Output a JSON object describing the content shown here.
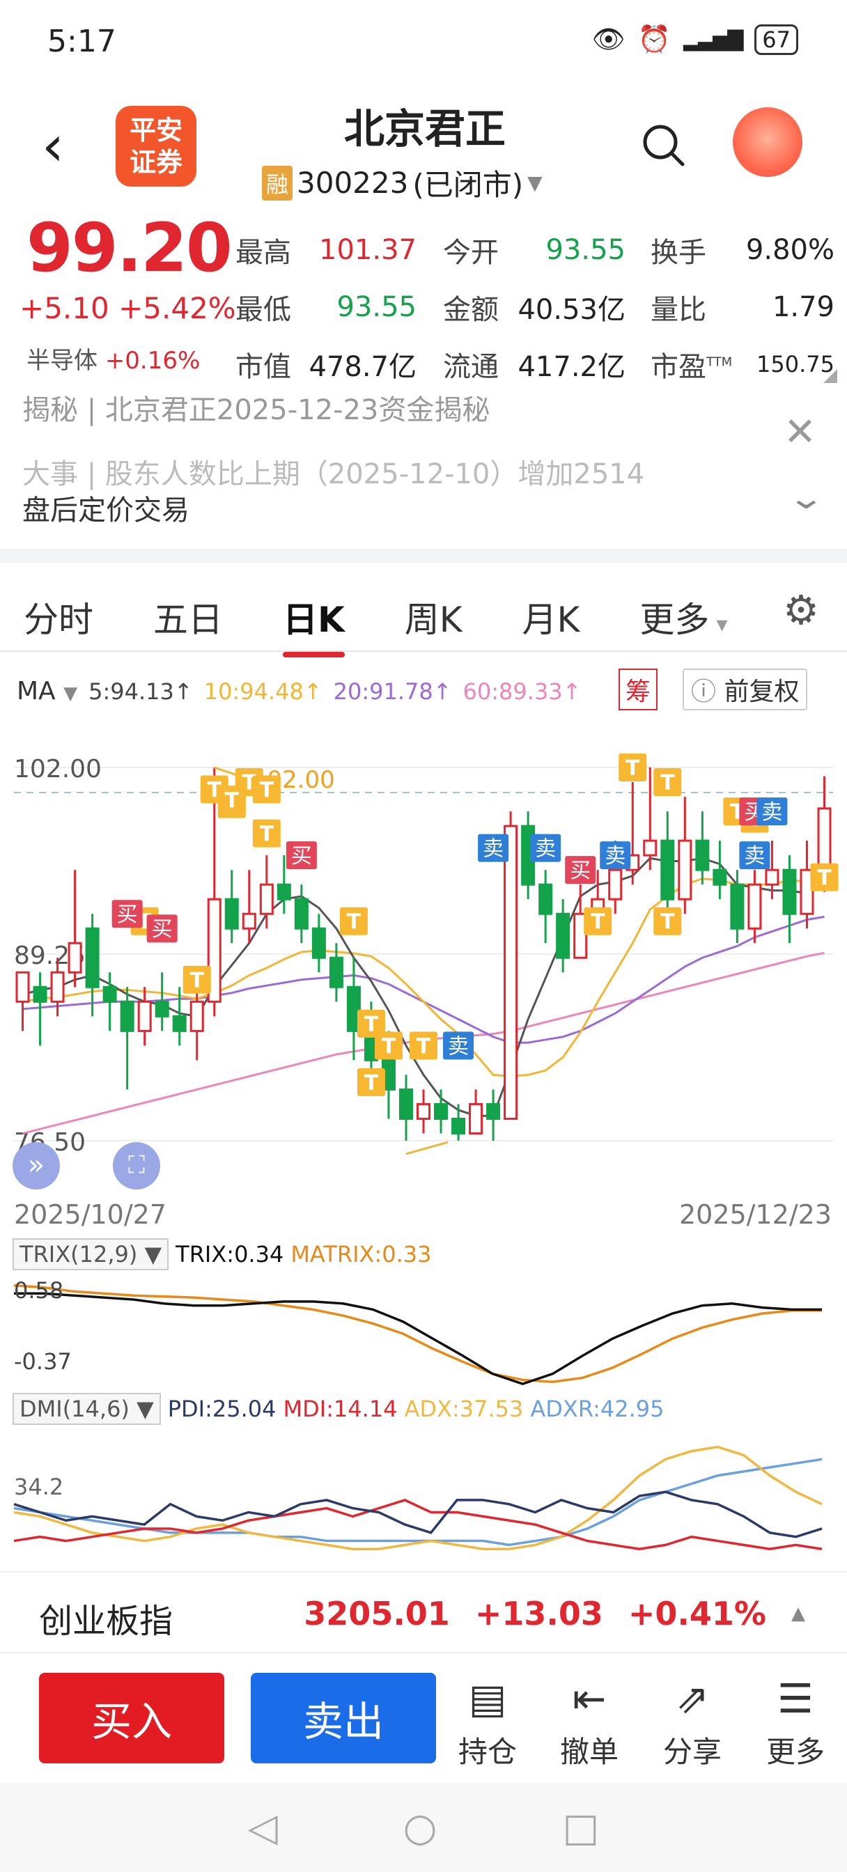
{
  "status_bar": {
    "time": "5:17",
    "battery": "67",
    "icons": [
      "eye-icon",
      "alarm-icon",
      "signal-icon"
    ]
  },
  "header": {
    "title": "北京君正",
    "code": "300223",
    "market_status": "(已闭市)",
    "rong": "融",
    "logo_line1": "平安",
    "logo_line2": "证券"
  },
  "quote": {
    "price": "99.20",
    "change": "+5.10",
    "change_pct": "+5.42%",
    "sector_name": "半导体",
    "sector_chg": "+0.16%",
    "rows": [
      [
        [
          "最高",
          "101.37",
          "red"
        ],
        [
          "今开",
          "93.55",
          "green"
        ],
        [
          "换手",
          "9.80%",
          "dark"
        ]
      ],
      [
        [
          "最低",
          "93.55",
          "green"
        ],
        [
          "金额",
          "40.53亿",
          "dark"
        ],
        [
          "量比",
          "1.79",
          "dark"
        ]
      ],
      [
        [
          "市值",
          "478.7亿",
          "dark"
        ],
        [
          "流通",
          "417.2亿",
          "dark"
        ],
        [
          "市盈",
          "150.75",
          "dark"
        ]
      ]
    ],
    "ttm": "TTM"
  },
  "news": {
    "line1": "揭秘   |   北京君正2025-12-23资金揭秘",
    "line2": "大事   |   股东人数比上期（2025-12-10）增加2514",
    "after_hours": "盘后定价交易"
  },
  "tabs": [
    "分时",
    "五日",
    "日K",
    "周K",
    "月K",
    "更多"
  ],
  "active_tab": "日K",
  "ma": {
    "label": "MA",
    "ma5": "5:94.13↑",
    "ma10": "10:94.48↑",
    "ma20": "20:91.78↑",
    "ma60": "60:89.33↑",
    "chip_btn": "筹",
    "adjust_btn": "前复权",
    "colors": {
      "ma5": "#555555",
      "ma10": "#f2b636",
      "ma20": "#9b6ad6",
      "ma60": "#ee84b8"
    }
  },
  "chart_data": {
    "type": "candlestick",
    "y_labels": [
      "102.00",
      "89.25",
      "76.50"
    ],
    "ylim": [
      74.5,
      104.0
    ],
    "high_annot": "102.00",
    "low_annot": "76.50",
    "x_start": "2025/10/27",
    "x_end": "2025/12/23",
    "candles": [
      [
        86,
        88,
        84,
        87
      ],
      [
        87,
        86,
        83,
        88
      ],
      [
        86,
        88,
        85,
        89
      ],
      [
        88,
        90,
        87,
        95
      ],
      [
        91,
        87,
        85,
        92
      ],
      [
        87,
        86,
        84,
        88
      ],
      [
        86,
        84,
        80,
        87
      ],
      [
        84,
        86,
        83,
        87
      ],
      [
        86,
        85,
        84,
        88
      ],
      [
        85,
        84,
        83,
        87
      ],
      [
        84,
        86,
        82,
        87
      ],
      [
        86,
        93,
        85,
        102
      ],
      [
        93,
        91,
        90,
        95
      ],
      [
        91,
        92,
        90,
        95
      ],
      [
        92,
        94,
        91,
        96
      ],
      [
        94,
        93,
        92,
        96
      ],
      [
        93,
        91,
        90,
        94
      ],
      [
        91,
        89,
        88,
        92
      ],
      [
        89,
        87,
        86,
        90
      ],
      [
        87,
        84,
        82,
        89
      ],
      [
        84,
        82,
        80,
        86
      ],
      [
        82,
        80,
        78,
        84
      ],
      [
        80,
        78,
        76.5,
        81
      ],
      [
        78,
        79,
        77,
        80
      ],
      [
        79,
        78,
        77,
        80
      ],
      [
        78,
        77,
        76.5,
        79
      ],
      [
        77,
        79,
        77,
        80
      ],
      [
        79,
        78,
        76.5,
        80
      ],
      [
        78,
        98,
        78,
        99
      ],
      [
        98,
        94,
        93,
        99
      ],
      [
        94,
        92,
        90,
        95
      ],
      [
        92,
        89,
        88,
        93
      ],
      [
        89,
        92,
        89,
        94
      ],
      [
        92,
        93,
        91,
        95
      ],
      [
        93,
        95,
        92,
        97
      ],
      [
        95,
        96,
        94,
        101
      ],
      [
        96,
        97,
        95,
        102
      ],
      [
        97,
        93,
        92,
        99
      ],
      [
        93,
        97,
        92,
        100
      ],
      [
        97,
        95,
        94,
        99
      ],
      [
        95,
        94,
        93,
        97
      ],
      [
        94,
        91,
        90,
        95
      ],
      [
        91,
        94,
        90,
        95
      ],
      [
        94,
        95,
        93,
        97
      ],
      [
        95,
        92,
        90,
        96
      ],
      [
        92,
        95,
        91,
        97
      ],
      [
        95,
        99.2,
        93.5,
        101.4
      ]
    ],
    "ma5": [
      86.5,
      86.8,
      87,
      87.5,
      87.8,
      87.2,
      86.5,
      86,
      85.8,
      85.2,
      85,
      87,
      88.5,
      90,
      92,
      93,
      93.2,
      92.4,
      91,
      89,
      87.4,
      85.4,
      83,
      81,
      79.4,
      78.6,
      78.2,
      78.2,
      81.4,
      84.8,
      87.6,
      90.4,
      93.2,
      94,
      94.2,
      94.6,
      95.8,
      95.6,
      95.6,
      95.8,
      95.4,
      94,
      93.8,
      93.6,
      93.6,
      93.4,
      94.1
    ],
    "ma10": [
      86,
      86.2,
      86.3,
      86.5,
      86.7,
      86.8,
      86.8,
      86.7,
      86.6,
      86.4,
      86.2,
      86.6,
      87.1,
      87.8,
      88.3,
      88.9,
      89.4,
      89.5,
      89.4,
      89.3,
      89.1,
      88.3,
      87.2,
      86,
      84.8,
      83.8,
      82.4,
      81,
      80.9,
      81,
      81.3,
      82.2,
      83.9,
      86,
      88,
      90,
      92.3,
      93.2,
      94,
      94.4,
      94.3,
      94,
      94,
      94,
      94.3,
      94.2,
      94.5
    ],
    "ma20": [
      85.5,
      85.6,
      85.7,
      85.8,
      85.9,
      86,
      86,
      86,
      86.1,
      86.2,
      86.2,
      86.4,
      86.6,
      86.9,
      87.1,
      87.3,
      87.5,
      87.6,
      87.7,
      87.8,
      87.6,
      87.2,
      86.6,
      86,
      85.4,
      84.8,
      84.2,
      83.6,
      83.2,
      83.2,
      83.4,
      83.6,
      84,
      84.6,
      85.2,
      86,
      86.8,
      87.6,
      88.4,
      89,
      89.4,
      89.8,
      90.4,
      90.8,
      91.2,
      91.6,
      91.8
    ],
    "ma60": [
      77,
      77.3,
      77.6,
      77.9,
      78.2,
      78.5,
      78.8,
      79.1,
      79.4,
      79.7,
      80,
      80.3,
      80.6,
      80.9,
      81.2,
      81.5,
      81.8,
      82.1,
      82.4,
      82.6,
      82.8,
      83,
      83.2,
      83.4,
      83.5,
      83.6,
      83.7,
      83.8,
      84,
      84.3,
      84.6,
      84.9,
      85.2,
      85.5,
      85.8,
      86.1,
      86.4,
      86.7,
      87,
      87.3,
      87.6,
      87.9,
      88.2,
      88.5,
      88.8,
      89.1,
      89.33
    ],
    "marks": [
      {
        "i": 6,
        "t": "买",
        "price": 92
      },
      {
        "i": 8,
        "t": "买",
        "price": 91
      },
      {
        "i": 16,
        "t": "买",
        "price": 96
      },
      {
        "i": 25,
        "t": "卖",
        "price": 83
      },
      {
        "i": 27,
        "t": "卖",
        "price": 96.5
      },
      {
        "i": 30,
        "t": "卖",
        "price": 96.5
      },
      {
        "i": 32,
        "t": "买",
        "price": 95
      },
      {
        "i": 34,
        "t": "卖",
        "price": 96
      },
      {
        "i": 42,
        "t": "买",
        "price": 99
      },
      {
        "i": 43,
        "t": "卖",
        "price": 99
      },
      {
        "i": 42,
        "t": "卖",
        "price": 96
      }
    ],
    "t_marks": [
      {
        "i": 11,
        "price": 100.5
      },
      {
        "i": 12,
        "price": 99.5
      },
      {
        "i": 13,
        "price": 101
      },
      {
        "i": 12,
        "price": 99.8
      },
      {
        "i": 14,
        "price": 100.5
      },
      {
        "i": 14,
        "price": 97.5
      },
      {
        "i": 7,
        "price": 91.5
      },
      {
        "i": 10,
        "price": 87.5
      },
      {
        "i": 19,
        "price": 91.5
      },
      {
        "i": 20,
        "price": 84.5
      },
      {
        "i": 21,
        "price": 83
      },
      {
        "i": 23,
        "price": 83
      },
      {
        "i": 20,
        "price": 80.5
      },
      {
        "i": 33,
        "price": 91.5
      },
      {
        "i": 37,
        "price": 91.5
      },
      {
        "i": 35,
        "price": 102
      },
      {
        "i": 37,
        "price": 101
      },
      {
        "i": 41,
        "price": 99
      },
      {
        "i": 42,
        "price": 98.5
      },
      {
        "i": 46,
        "price": 94.5
      }
    ]
  },
  "trix": {
    "name": "TRIX(12,9)",
    "trix_val": "TRIX:0.34",
    "matrix_val": "MATRIX:0.33",
    "y_top": "0.58",
    "y_bottom": "-0.37",
    "trix_series": [
      0.5,
      0.5,
      0.48,
      0.46,
      0.44,
      0.4,
      0.38,
      0.38,
      0.4,
      0.42,
      0.42,
      0.4,
      0.34,
      0.22,
      0.05,
      -0.12,
      -0.3,
      -0.4,
      -0.3,
      -0.12,
      0.05,
      0.18,
      0.3,
      0.38,
      0.4,
      0.36,
      0.34,
      0.34
    ],
    "matrix_series": [
      0.58,
      0.56,
      0.52,
      0.5,
      0.48,
      0.47,
      0.46,
      0.44,
      0.42,
      0.38,
      0.34,
      0.28,
      0.2,
      0.1,
      -0.05,
      -0.18,
      -0.3,
      -0.36,
      -0.38,
      -0.34,
      -0.24,
      -0.1,
      0.05,
      0.16,
      0.24,
      0.3,
      0.33,
      0.33
    ]
  },
  "dmi": {
    "name": "DMI(14,6)",
    "pdi": "PDI:25.04",
    "mdi": "MDI:14.14",
    "adx": "ADX:37.53",
    "adxr": "ADXR:42.95",
    "y_label": "34.2",
    "pdi_series": [
      34,
      30,
      26,
      28,
      26,
      24,
      34,
      28,
      26,
      30,
      28,
      34,
      36,
      32,
      30,
      24,
      20,
      36,
      36,
      34,
      30,
      36,
      32,
      30,
      38,
      40,
      36,
      34,
      28,
      20,
      18,
      22
    ],
    "mdi_series": [
      16,
      18,
      16,
      18,
      20,
      22,
      22,
      20,
      22,
      26,
      28,
      30,
      32,
      28,
      32,
      36,
      30,
      30,
      28,
      26,
      24,
      20,
      16,
      14,
      12,
      14,
      18,
      16,
      14,
      12,
      14,
      12
    ],
    "adx_series": [
      30,
      28,
      24,
      20,
      18,
      16,
      18,
      22,
      24,
      20,
      18,
      16,
      14,
      12,
      12,
      14,
      16,
      14,
      12,
      12,
      14,
      18,
      26,
      36,
      48,
      56,
      60,
      62,
      58,
      48,
      40,
      34
    ],
    "adxr_series": [
      32,
      30,
      28,
      26,
      24,
      22,
      20,
      20,
      20,
      20,
      18,
      18,
      16,
      16,
      16,
      16,
      16,
      16,
      16,
      14,
      16,
      18,
      22,
      28,
      36,
      40,
      44,
      48,
      50,
      52,
      54,
      56
    ]
  },
  "index_bar": {
    "name": "创业板指",
    "value": "3205.01",
    "change": "+13.03",
    "pct": "+0.41%"
  },
  "actions": {
    "buy": "买入",
    "sell": "卖出",
    "items": [
      {
        "label": "持仓",
        "icon": "position-icon"
      },
      {
        "label": "撤单",
        "icon": "cancel-order-icon"
      },
      {
        "label": "分享",
        "icon": "share-icon"
      },
      {
        "label": "更多",
        "icon": "more-icon"
      }
    ]
  }
}
